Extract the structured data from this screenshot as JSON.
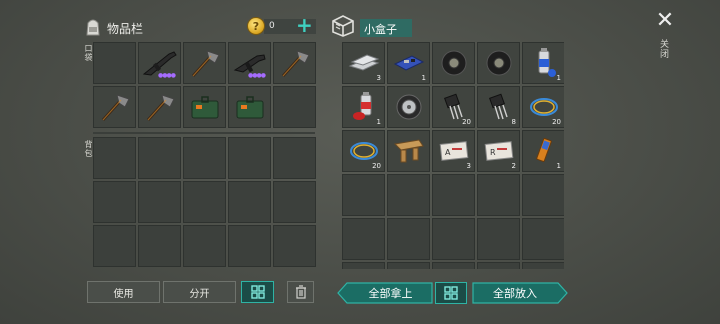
{
  "left_panel": {
    "title": "物品栏",
    "coin_count": "0",
    "coin_symbol": "?",
    "plus_label": "+",
    "pocket_label": "口袋",
    "backpack_label": "背包",
    "pocket_items": [
      {
        "icon": "empty-slot",
        "qty": ""
      },
      {
        "icon": "assault-rifle-icon",
        "qty": "",
        "dots": "●●●●"
      },
      {
        "icon": "hatchet-icon",
        "qty": ""
      },
      {
        "icon": "submachine-gun-icon",
        "qty": "",
        "dots": "●●●●"
      },
      {
        "icon": "hatchet-icon",
        "qty": ""
      },
      {
        "icon": "hatchet-icon",
        "qty": ""
      },
      {
        "icon": "hatchet-icon",
        "qty": ""
      },
      {
        "icon": "backpack-bag-icon",
        "qty": ""
      },
      {
        "icon": "backpack-bag-icon",
        "qty": ""
      },
      {
        "icon": "empty-slot",
        "qty": ""
      }
    ]
  },
  "right_panel": {
    "title": "小盒子",
    "items": [
      {
        "icon": "metal-plates-icon",
        "qty": "3"
      },
      {
        "icon": "circuit-board-icon",
        "qty": "1"
      },
      {
        "icon": "tire-icon",
        "qty": ""
      },
      {
        "icon": "tire-icon",
        "qty": ""
      },
      {
        "icon": "spray-can-blue-icon",
        "qty": "1"
      },
      {
        "icon": "spray-can-red-icon",
        "qty": "1"
      },
      {
        "icon": "wheel-icon",
        "qty": ""
      },
      {
        "icon": "transistor-icon",
        "qty": "20"
      },
      {
        "icon": "transistor-icon",
        "qty": "8"
      },
      {
        "icon": "wire-coil-icon",
        "qty": "20"
      },
      {
        "icon": "wire-coil-icon",
        "qty": "20"
      },
      {
        "icon": "wooden-parts-icon",
        "qty": ""
      },
      {
        "icon": "recipe-card-a-icon",
        "qty": "3"
      },
      {
        "icon": "recipe-card-r-icon",
        "qty": "2"
      },
      {
        "icon": "battery-icon",
        "qty": "1"
      }
    ]
  },
  "close": {
    "symbol": "✕",
    "label": "关闭"
  },
  "buttons": {
    "use": "使用",
    "split": "分开",
    "take_all": "全部拿上",
    "put_all": "全部放入"
  },
  "colors": {
    "accent": "#2fb3a5",
    "teal_dark": "#1b6d64",
    "cell": "#3c403c"
  }
}
